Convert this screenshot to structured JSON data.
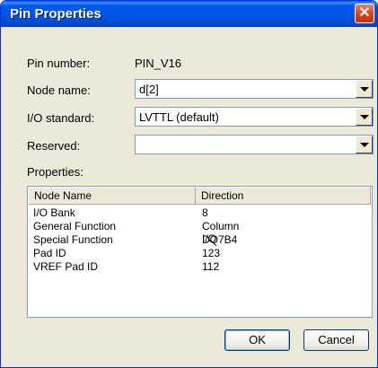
{
  "window": {
    "title": "Pin Properties"
  },
  "fields": {
    "pin_number_label": "Pin number:",
    "pin_number_value": "PIN_V16",
    "node_name_label": "Node name:",
    "node_name_value": "d[2]",
    "io_standard_label": "I/O standard:",
    "io_standard_value": "LVTTL (default)",
    "reserved_label": "Reserved:",
    "reserved_value": ""
  },
  "properties": {
    "label": "Properties:",
    "columns": [
      "Node Name",
      "Direction"
    ],
    "rows": [
      [
        "I/O Bank",
        "8"
      ],
      [
        "General Function",
        "Column I/O"
      ],
      [
        "Special Function",
        "DQ7B4"
      ],
      [
        "Pad ID",
        "123"
      ],
      [
        "VREF Pad ID",
        "112"
      ]
    ]
  },
  "buttons": {
    "ok": "OK",
    "cancel": "Cancel"
  },
  "colors": {
    "title_bar": "#0054e3",
    "dialog_bg": "#ece9d8",
    "close_button": "#d5421f"
  }
}
